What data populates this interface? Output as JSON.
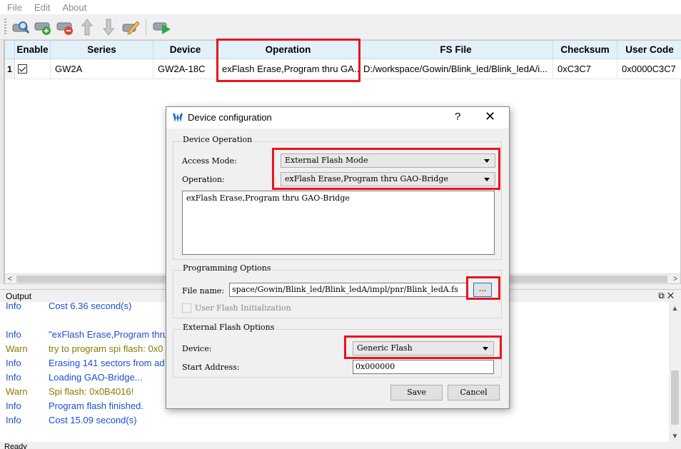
{
  "menu": [
    "File",
    "Edit",
    "About"
  ],
  "toolbar": {
    "icons": [
      "scan-device-icon",
      "add-device-icon",
      "remove-device-icon",
      "move-up-icon",
      "move-down-icon",
      "edit-config-icon",
      "program-icon"
    ]
  },
  "table": {
    "headers": [
      "Enable",
      "Series",
      "Device",
      "Operation",
      "FS File",
      "Checksum",
      "User Code"
    ],
    "rows": [
      {
        "num": "1",
        "enabled": true,
        "series": "GW2A",
        "device": "GW2A-18C",
        "operation": "exFlash Erase,Program thru GA...",
        "fs_file": "D:/workspace/Gowin/Blink_led/Blink_ledA/i...",
        "checksum": "0xC3C7",
        "user_code": "0x0000C3C7"
      }
    ]
  },
  "output": {
    "title": "Output",
    "logs": [
      {
        "level": "Info",
        "msg": "Cost 6.36 second(s)",
        "color": "#1a4fd6"
      },
      {
        "level": "Info",
        "msg": "\"exFlash Erase,Program thru",
        "color": "#1a4fd6"
      },
      {
        "level": "Warn",
        "msg": "try to program spi flash: 0x0",
        "color": "#8a7a00"
      },
      {
        "level": "Info",
        "msg": "Erasing 141 sectors from ad",
        "color": "#1a4fd6"
      },
      {
        "level": "Info",
        "msg": "Loading GAO-Bridge...",
        "color": "#1a4fd6"
      },
      {
        "level": "Warn",
        "msg": "Spi flash: 0x0B4016!",
        "color": "#8a7a00"
      },
      {
        "level": "Info",
        "msg": "Program flash finished.",
        "color": "#1a4fd6"
      },
      {
        "level": "Info",
        "msg": "Cost 15.09 second(s)",
        "color": "#1a4fd6"
      }
    ]
  },
  "status": "Ready",
  "dialog": {
    "title": "Device configuration",
    "help": "?",
    "close": "✕",
    "device_operation": {
      "group_title": "Device Operation",
      "access_mode_label": "Access Mode:",
      "access_mode_value": "External Flash Mode",
      "operation_label": "Operation:",
      "operation_value": "exFlash Erase,Program thru GAO-Bridge",
      "description": "exFlash Erase,Program thru GAO-Bridge"
    },
    "programming_options": {
      "group_title": "Programming Options",
      "file_name_label": "File name:",
      "file_name_value": "space/Gowin/Blink_led/Blink_ledA/impl/pnr/Blink_ledA.fs",
      "browse_label": "...",
      "user_flash_label": "User Flash Initialization"
    },
    "external_flash": {
      "group_title": "External Flash Options",
      "device_label": "Device:",
      "device_value": "Generic Flash",
      "start_address_label": "Start Address:",
      "start_address_value": "0x000000"
    },
    "save_label": "Save",
    "cancel_label": "Cancel"
  },
  "colors": {
    "header_bg": "#e3f1fb",
    "highlight": "#e8141e",
    "info": "#1a4fd6",
    "warn": "#8a7a00"
  }
}
